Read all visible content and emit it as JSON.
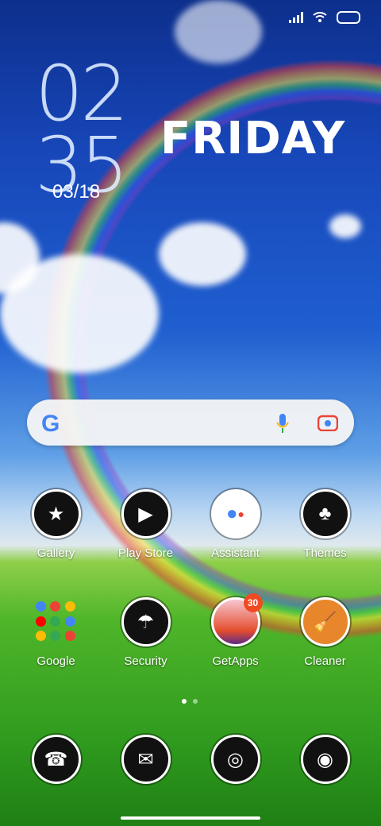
{
  "status_bar": {
    "icons": [
      "signal-icon",
      "wifi-icon",
      "battery-icon"
    ]
  },
  "clock": {
    "hour": "02",
    "minute": "35",
    "date": "03/18",
    "day": "FRIDAY"
  },
  "search_bar": {
    "logo": "G"
  },
  "apps_row1": [
    {
      "label": "Gallery",
      "icon": "gallery-icon"
    },
    {
      "label": "Play Store",
      "icon": "play-store-icon"
    },
    {
      "label": "Assistant",
      "icon": "assistant-icon"
    },
    {
      "label": "Themes",
      "icon": "themes-icon"
    }
  ],
  "apps_row2": [
    {
      "label": "Google",
      "icon": "google-folder-icon"
    },
    {
      "label": "Security",
      "icon": "security-icon"
    },
    {
      "label": "GetApps",
      "icon": "getapps-icon",
      "badge": "30"
    },
    {
      "label": "Cleaner",
      "icon": "cleaner-icon"
    }
  ],
  "dock": [
    {
      "icon": "phone-icon"
    },
    {
      "icon": "messages-icon"
    },
    {
      "icon": "browser-icon"
    },
    {
      "icon": "camera-icon"
    }
  ],
  "colors": {
    "accent": "#f04a23",
    "google_blue": "#4285f4"
  }
}
